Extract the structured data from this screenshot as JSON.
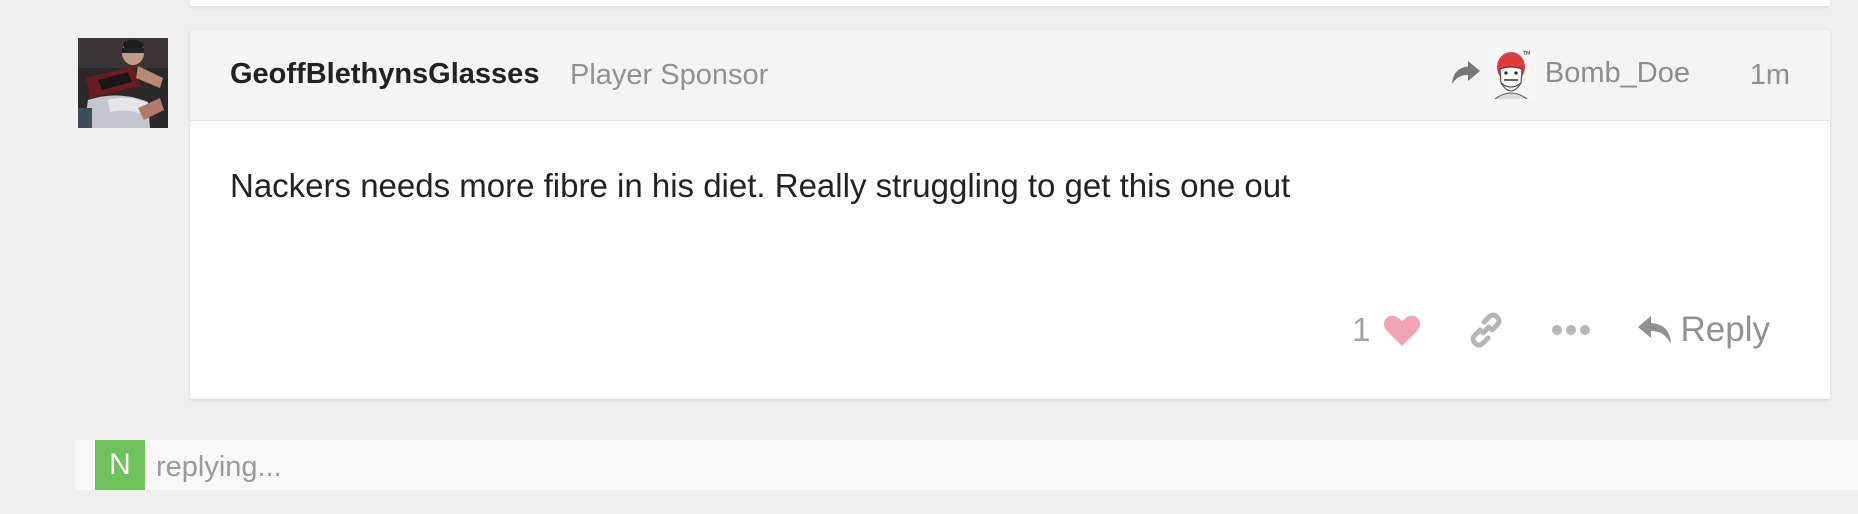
{
  "post": {
    "username": "GeoffBlethynsGlasses",
    "user_title": "Player Sponsor",
    "reply_to_name": "Bomb_Doe",
    "age": "1m",
    "body": "Nackers needs more fibre in his diet. Really struggling to get this one out",
    "like_count": "1",
    "reply_label": "Reply"
  },
  "replying": {
    "avatar_letter": "N",
    "text": "replying..."
  },
  "icons": {
    "reply_to": "share-arrow-icon",
    "like": "heart-icon",
    "link": "link-icon",
    "more": "ellipsis-icon",
    "reply": "reply-arrow-icon"
  },
  "colors": {
    "heart": "#f3a4b4",
    "replying_avatar": "#6ec25a",
    "header_bg": "#f4f4f4",
    "page_bg": "#efefef"
  }
}
